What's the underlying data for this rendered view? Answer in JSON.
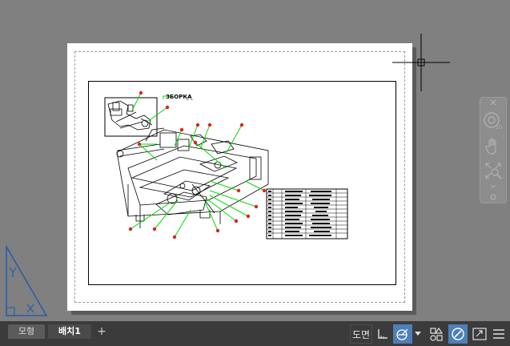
{
  "layout_tabs": {
    "model_label": "모형",
    "layout1_label": "배치1",
    "add_label": "+"
  },
  "statusbar": {
    "paper_space_label": "도면"
  },
  "drawing": {
    "title_label": "ЗБОРКА",
    "title_suffix": "_ _"
  },
  "icons": {
    "nav_wheel": "steering-wheel-icon",
    "pan": "pan-hand-icon",
    "zoom_extents": "zoom-extents-icon",
    "ortho": "ortho-mode-icon",
    "polar": "polar-tracking-icon",
    "annotation": "annotation-scale-icon",
    "isolate": "isolate-objects-icon",
    "fullscreen": "fullscreen-icon",
    "menu": "customization-menu-icon"
  },
  "colors": {
    "canvas": "#808080",
    "statusbar": "#3b3b3b",
    "active_button": "#4e7fb8",
    "balloon": "#e02020",
    "leader": "#00dd00"
  }
}
